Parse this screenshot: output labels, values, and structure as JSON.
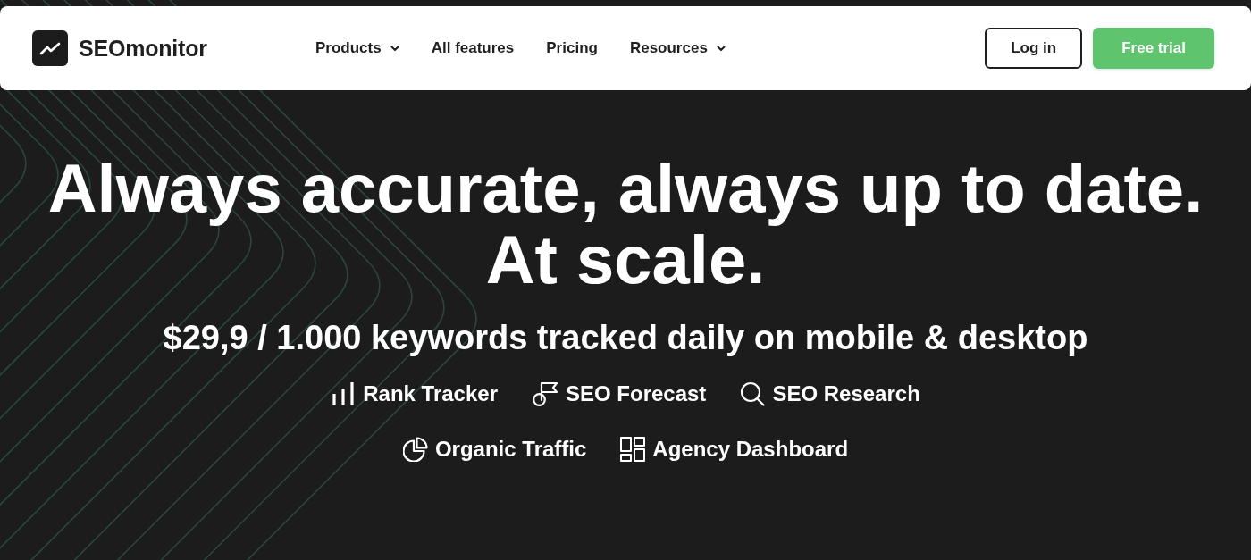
{
  "header": {
    "brand": "SEOmonitor",
    "nav": [
      {
        "label": "Products",
        "dropdown": true
      },
      {
        "label": "All features",
        "dropdown": false
      },
      {
        "label": "Pricing",
        "dropdown": false
      },
      {
        "label": "Resources",
        "dropdown": true
      }
    ],
    "buttons": [
      {
        "label": "Log in",
        "kind": "outline"
      },
      {
        "label": "Free trial",
        "kind": "primary"
      }
    ]
  },
  "hero": {
    "headline": "Always accurate, always up to date. At scale.",
    "subtitle": "$29,9 / 1.000 keywords tracked daily on mobile & desktop",
    "product_rows": [
      [
        {
          "label": "Rank Tracker",
          "kind": "tracker"
        },
        {
          "label": "SEO Forecast",
          "kind": "forecast"
        },
        {
          "label": "SEO Research",
          "kind": "research"
        }
      ],
      [
        {
          "label": "Organic Traffic",
          "kind": "traffic"
        },
        {
          "label": "Agency Dashboard",
          "kind": "dashboard"
        }
      ]
    ]
  }
}
